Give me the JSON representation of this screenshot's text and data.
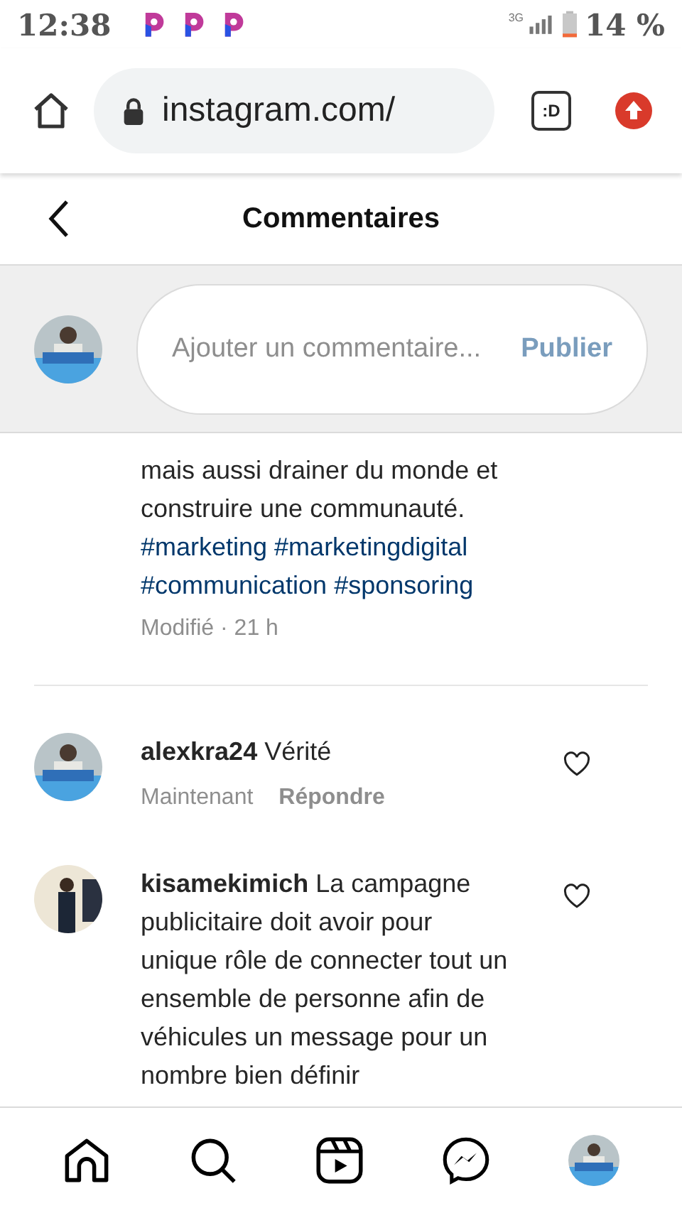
{
  "status_bar": {
    "time": "12:38",
    "network": "3G",
    "battery": "14 %"
  },
  "browser": {
    "url": "instagram.com/",
    "tab_badge": ":D"
  },
  "header": {
    "title": "Commentaires"
  },
  "composer": {
    "placeholder": "Ajouter un commentaire...",
    "submit": "Publier"
  },
  "comments": [
    {
      "kind": "partial",
      "text": "mais aussi drainer du monde et construire une communauté.",
      "hashtags": [
        "#marketing",
        "#marketingdigital",
        "#communication",
        "#sponsoring"
      ],
      "meta": "Modifié · 21 h"
    },
    {
      "kind": "reply",
      "username": "alexkra24",
      "text": "Vérité",
      "time": "Maintenant",
      "reply": "Répondre"
    },
    {
      "kind": "reply",
      "username": "kisamekimich",
      "text": "La campagne publicitaire doit avoir pour unique rôle de connecter tout un ensemble de personne afin de véhicules un message pour un nombre bien définir"
    }
  ]
}
